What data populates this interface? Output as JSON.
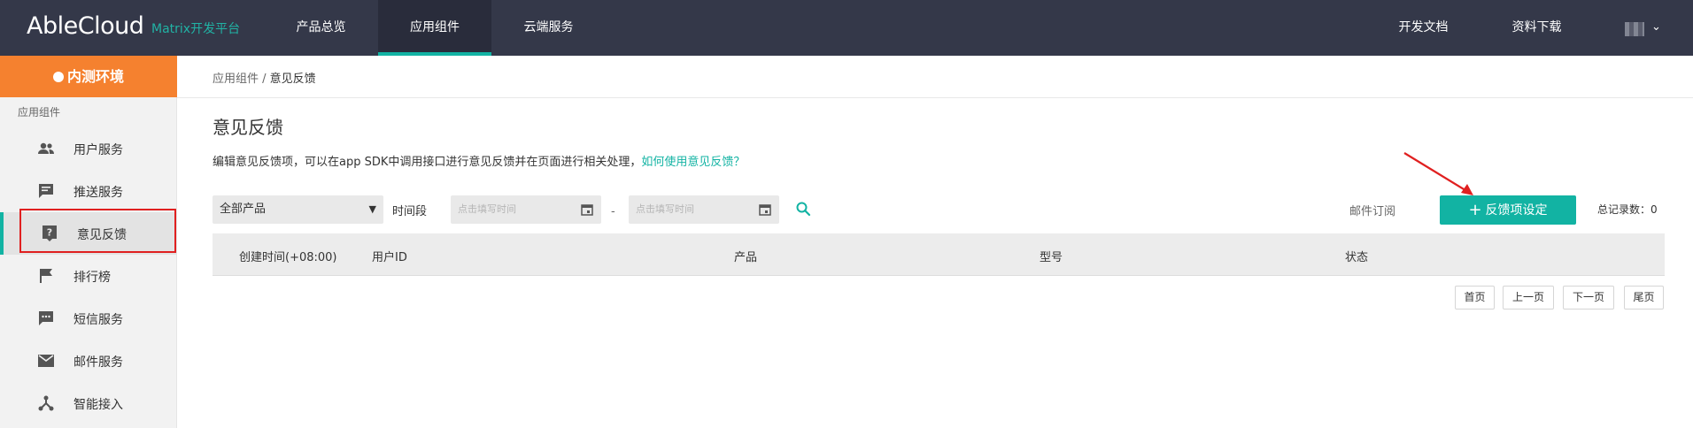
{
  "header": {
    "logo": "AbleCloud",
    "logo_sub": "Matrix开发平台",
    "nav": [
      "产品总览",
      "应用组件",
      "云端服务"
    ],
    "active_nav": "应用组件",
    "right_links": [
      "开发文档",
      "资料下载"
    ]
  },
  "sidebar": {
    "env_label": "内测环境",
    "group_label": "应用组件",
    "items": [
      {
        "label": "用户服务",
        "icon": "users-icon"
      },
      {
        "label": "推送服务",
        "icon": "message-icon"
      },
      {
        "label": "意见反馈",
        "icon": "feedback-icon"
      },
      {
        "label": "排行榜",
        "icon": "flag-icon"
      },
      {
        "label": "短信服务",
        "icon": "sms-icon"
      },
      {
        "label": "邮件服务",
        "icon": "mail-icon"
      },
      {
        "label": "智能接入",
        "icon": "network-icon"
      }
    ],
    "active_item": "意见反馈"
  },
  "breadcrumb": {
    "parent": "应用组件",
    "separator": " / ",
    "current": "意见反馈"
  },
  "page": {
    "title": "意见反馈",
    "description": "编辑意见反馈项，可以在app SDK中调用接口进行意见反馈并在页面进行相关处理，",
    "help_link": "如何使用意见反馈？"
  },
  "filters": {
    "product_select": "全部产品",
    "time_label": "时间段",
    "start_placeholder": "点击填写时间",
    "end_placeholder": "点击填写时间",
    "dash": "-"
  },
  "actions": {
    "mail_subscribe": "邮件订阅",
    "add_button": "反馈项设定",
    "total_label": "总记录数：",
    "total_value": "0"
  },
  "table": {
    "columns": [
      "创建时间(+08:00)",
      "用户ID",
      "产品",
      "型号",
      "状态"
    ],
    "rows": []
  },
  "pagination": [
    "首页",
    "上一页",
    "下一页",
    "尾页"
  ],
  "colors": {
    "accent": "#12b3a3",
    "env_badge": "#f5812f",
    "nav_bg": "#343849",
    "annotation": "#e02020"
  }
}
